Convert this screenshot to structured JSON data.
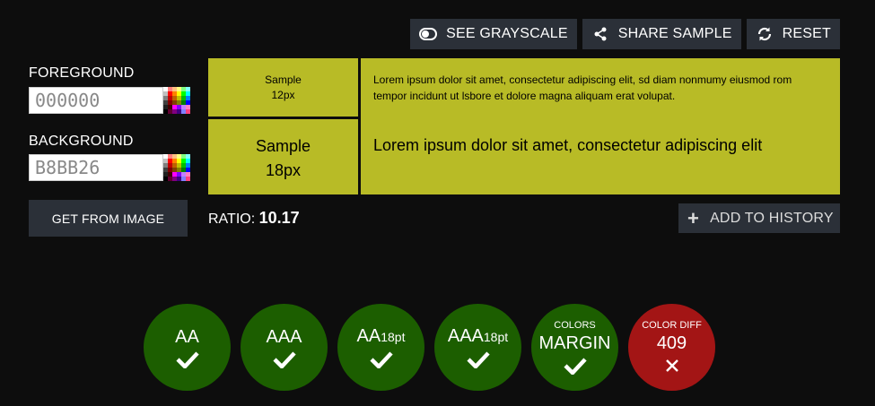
{
  "toolbar": {
    "grayscale_label": "SEE GRAYSCALE",
    "share_label": "SHARE SAMPLE",
    "reset_label": "RESET"
  },
  "foreground": {
    "label": "FOREGROUND",
    "value": "000000"
  },
  "background": {
    "label": "BACKGROUND",
    "value": "B8BB26"
  },
  "get_from_image_label": "GET FROM IMAGE",
  "sample": {
    "bg_color": "#b8bb26",
    "fg_color": "#000000",
    "small_line1": "Sample",
    "small_line2": "12px",
    "large_line1": "Sample",
    "large_line2": "18px",
    "text_small": "Lorem ipsum dolor sit amet, consectetur adipiscing elit, sd diam nonmumy eiusmod rom tempor incidunt ut lsbore et dolore magna aliquam erat volupat.",
    "text_large": "Lorem ipsum dolor sit amet, consectetur adipiscing elit"
  },
  "ratio": {
    "label": "RATIO:",
    "value": "10.17"
  },
  "add_history_label": "ADD TO HISTORY",
  "results": [
    {
      "top": "",
      "main": "AA",
      "sub": "",
      "pass": true
    },
    {
      "top": "",
      "main": "AAA",
      "sub": "",
      "pass": true
    },
    {
      "top": "",
      "main": "AA",
      "sub": "18pt",
      "pass": true
    },
    {
      "top": "",
      "main": "AAA",
      "sub": "18pt",
      "pass": true
    },
    {
      "top": "COLORS",
      "main": "MARGIN",
      "sub": "",
      "pass": true
    },
    {
      "top": "COLOR DIFF",
      "main": "409",
      "sub": "",
      "pass": false
    }
  ],
  "colors": {
    "pass": "#1c5e00",
    "fail": "#a31515",
    "button": "#2b3038"
  },
  "icons": [
    "toggle-icon",
    "share-icon",
    "refresh-icon",
    "palette-icon",
    "plus-icon",
    "check-icon",
    "cross-icon"
  ]
}
